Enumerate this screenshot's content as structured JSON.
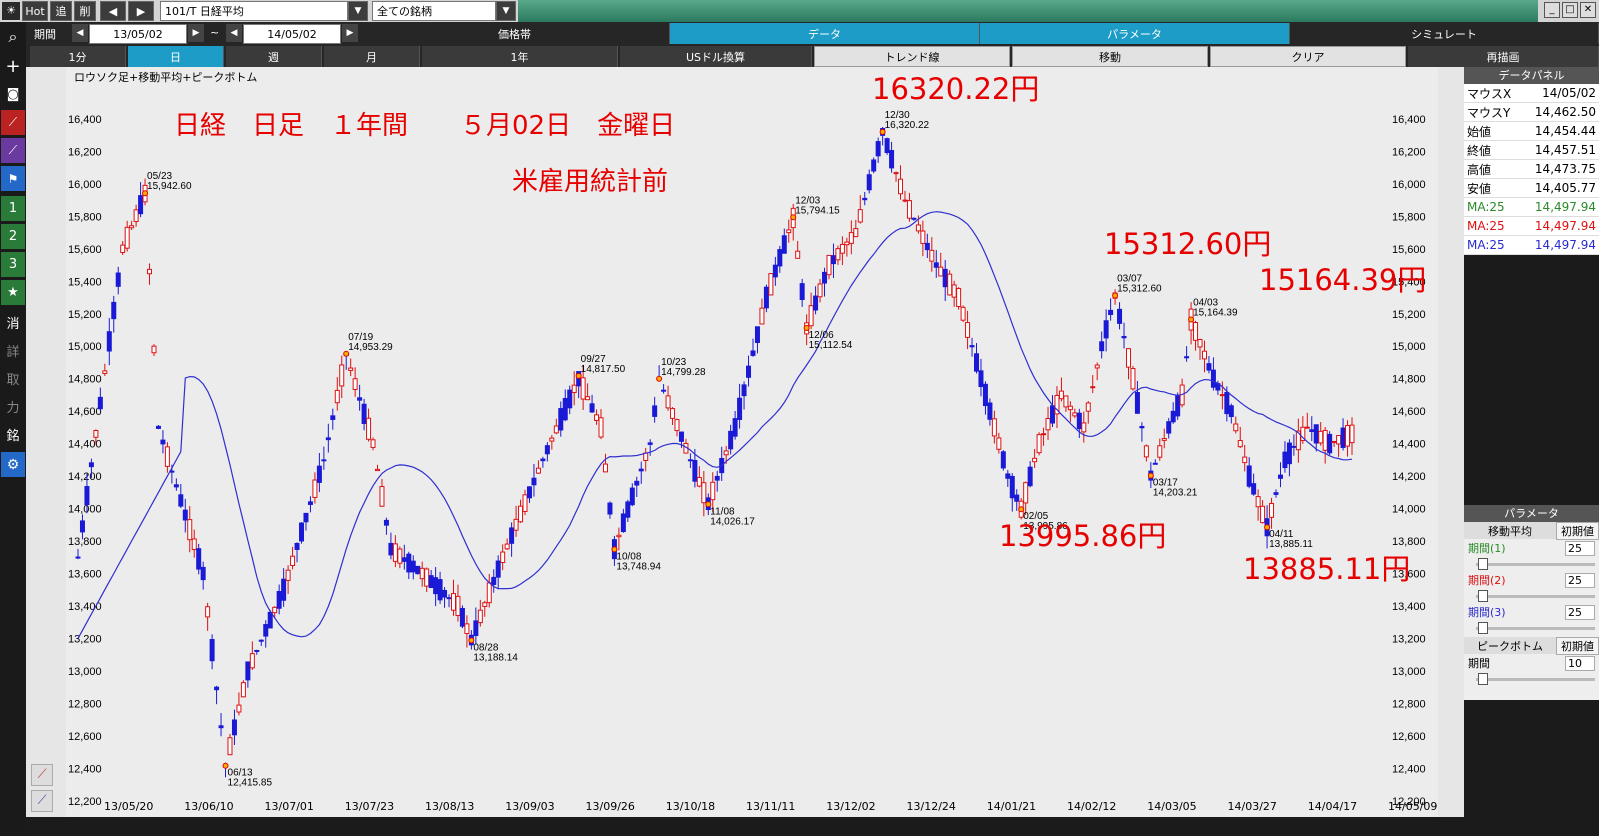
{
  "toolbar": {
    "hot": "Hot",
    "add": "追",
    "del": "削",
    "symbol": "101/T 日経平均",
    "filter": "全ての銘柄"
  },
  "period": {
    "label": "期間",
    "from": "13/05/02",
    "tilde": "~",
    "to": "14/05/02"
  },
  "menu_tabs": [
    "価格帯",
    "データ",
    "パラメータ",
    "シミュレート"
  ],
  "range_tabs": [
    "1分",
    "日",
    "週",
    "月",
    "1年",
    "USドル換算",
    "トレンド線",
    "移動",
    "クリア",
    "再描画"
  ],
  "sidebar_labels": [
    "1",
    "2",
    "3",
    "★",
    "消",
    "詳",
    "取",
    "力",
    "銘"
  ],
  "chart_data": {
    "type": "candlestick",
    "title": "ロウソク足+移動平均+ピークボトム",
    "headline": "日経　日足　１年間　　５月02日　金曜日",
    "subheadline": "米雇用統計前",
    "yticks": [
      16400,
      16200,
      16000,
      15800,
      15600,
      15400,
      15200,
      15000,
      14800,
      14600,
      14400,
      14200,
      14000,
      13800,
      13600,
      13400,
      13200,
      13000,
      12800,
      12600,
      12400,
      12200
    ],
    "ylim": [
      12100,
      16720
    ],
    "xticks": [
      "13/05/20",
      "13/06/10",
      "13/07/01",
      "13/07/23",
      "13/08/13",
      "13/09/03",
      "13/09/26",
      "13/10/18",
      "13/11/11",
      "13/12/02",
      "13/12/24",
      "14/01/21",
      "14/02/12",
      "14/03/05",
      "14/03/27",
      "14/04/17",
      "14/05/09"
    ],
    "peaks": [
      {
        "date": "05/23",
        "value": "15,942.60"
      },
      {
        "date": "06/13",
        "value": "12,415.85"
      },
      {
        "date": "07/19",
        "value": "14,953.29"
      },
      {
        "date": "08/28",
        "value": "13,188.14"
      },
      {
        "date": "09/27",
        "value": "14,817.50"
      },
      {
        "date": "10/08",
        "value": "13,748.94"
      },
      {
        "date": "10/23",
        "value": "14,799.28"
      },
      {
        "date": "11/08",
        "value": "14,026.17"
      },
      {
        "date": "12/03",
        "value": "15,794.15"
      },
      {
        "date": "12/06",
        "value": "15,112.54"
      },
      {
        "date": "12/30",
        "value": "16,320.22"
      },
      {
        "date": "02/05",
        "value": "13,995.86"
      },
      {
        "date": "03/07",
        "value": "15,312.60"
      },
      {
        "date": "03/17",
        "value": "14,203.21"
      },
      {
        "date": "04/03",
        "value": "15,164.39"
      },
      {
        "date": "04/11",
        "value": "13,885.11"
      }
    ],
    "annotations": [
      "16320.22円",
      "15312.60円",
      "15164.39円",
      "13995.86円",
      "13885.11円"
    ],
    "ma_label": "MA:25",
    "colors": {
      "up": "#d11",
      "down": "#1a1ad6",
      "ma": "#2f2fd0",
      "peak": "#e60000"
    }
  },
  "data_panel": {
    "title": "データパネル",
    "rows": [
      {
        "k": "マウスX",
        "v": "14/05/02"
      },
      {
        "k": "マウスY",
        "v": "14,462.50"
      },
      {
        "k": "始値",
        "v": "14,454.44"
      },
      {
        "k": "終値",
        "v": "14,457.51"
      },
      {
        "k": "高値",
        "v": "14,473.75"
      },
      {
        "k": "安値",
        "v": "14,405.77"
      },
      {
        "k": "MA:25",
        "v": "14,497.94"
      },
      {
        "k": "MA:25",
        "v": "14,497.94"
      },
      {
        "k": "MA:25",
        "v": "14,497.94"
      }
    ]
  },
  "param_panel": {
    "title": "パラメータ",
    "ma_label": "移動平均",
    "default_label": "初期値",
    "p1": "期間(1)",
    "p1v": "25",
    "p2": "期間(2)",
    "p2v": "25",
    "p3": "期間(3)",
    "p3v": "25",
    "pb_label": "ピークボトム",
    "pb_default": "初期値",
    "pb_period": "期間",
    "pb_period_v": "10"
  }
}
